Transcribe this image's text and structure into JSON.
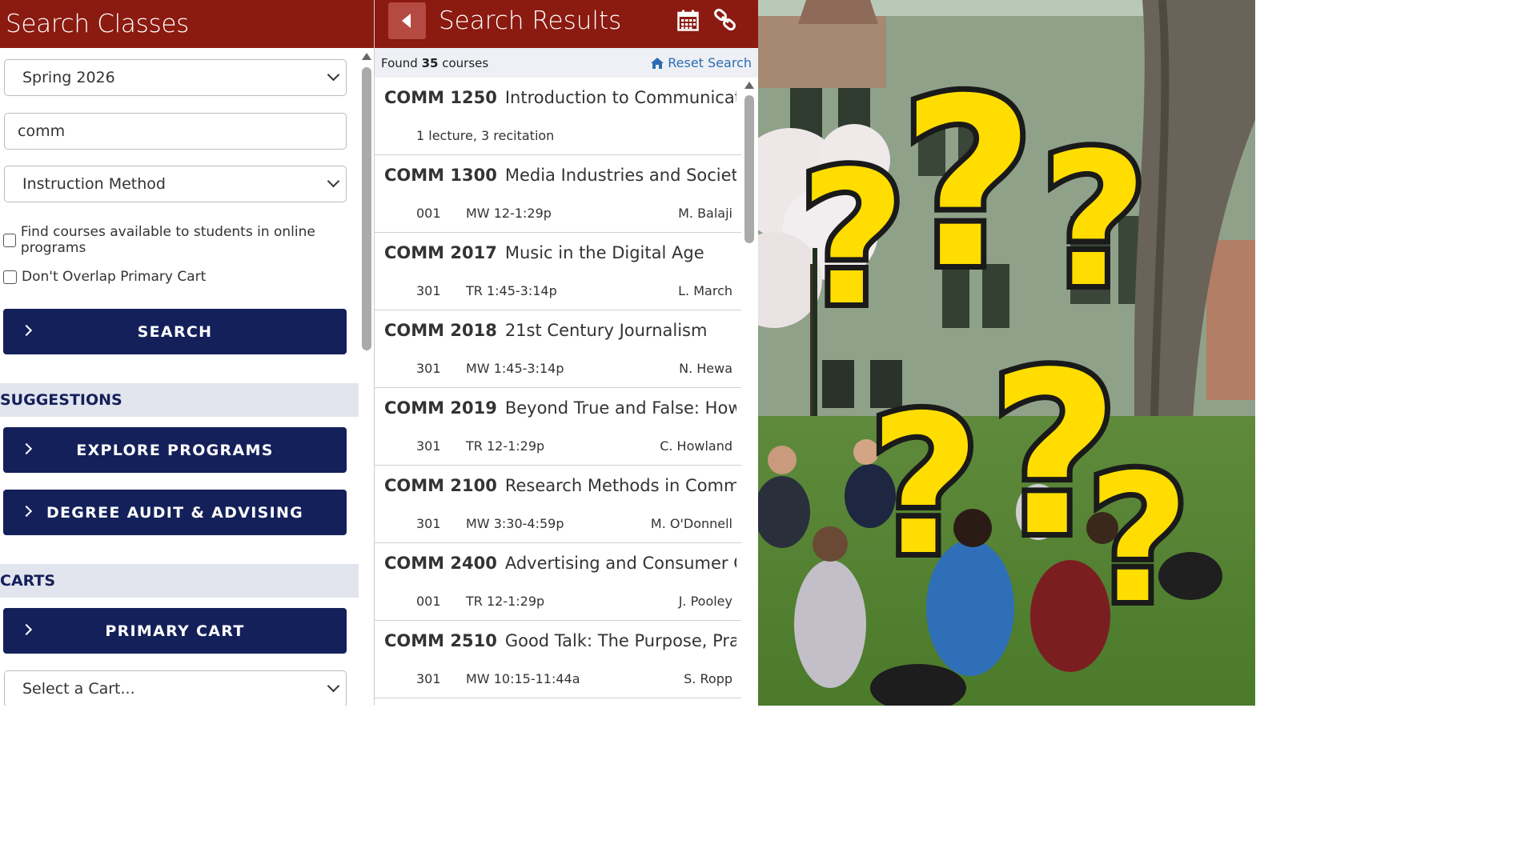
{
  "left": {
    "title": "Search Classes",
    "term_select": "Spring 2026",
    "keyword_value": "comm",
    "instruction_select": "Instruction Method",
    "online_checkbox_label": "Find courses available to students in online programs",
    "overlap_checkbox_label": "Don't Overlap Primary Cart",
    "search_button": "SEARCH",
    "suggestions_heading": "SUGGESTIONS",
    "explore_button": "EXPLORE PROGRAMS",
    "degree_button": "DEGREE AUDIT & ADVISING",
    "carts_heading": "CARTS",
    "primary_cart_button": "PRIMARY CART",
    "cart_select": "Select a Cart..."
  },
  "middle": {
    "title": "Search Results",
    "found_prefix": "Found",
    "found_count": "35",
    "found_suffix": "courses",
    "reset_label": "Reset Search",
    "results": [
      {
        "code": "COMM 1250",
        "title": "Introduction to Communicati...",
        "summary": "1 lecture, 3 recitation"
      },
      {
        "code": "COMM 1300",
        "title": "Media Industries and Society",
        "section": "001",
        "time": "MW 12-1:29p",
        "instructor": "M. Balaji"
      },
      {
        "code": "COMM 2017",
        "title": "Music in the Digital Age",
        "section": "301",
        "time": "TR 1:45-3:14p",
        "instructor": "L. March"
      },
      {
        "code": "COMM 2018",
        "title": "21st Century Journalism",
        "section": "301",
        "time": "MW 1:45-3:14p",
        "instructor": "N. Hewa"
      },
      {
        "code": "COMM 2019",
        "title": "Beyond True and False: How ...",
        "section": "301",
        "time": "TR 12-1:29p",
        "instructor": "C. Howland"
      },
      {
        "code": "COMM 2100",
        "title": "Research Methods in Comm...",
        "section": "301",
        "time": "MW 3:30-4:59p",
        "instructor": "M. O'Donnell"
      },
      {
        "code": "COMM 2400",
        "title": "Advertising and Consumer C...",
        "section": "001",
        "time": "TR 12-1:29p",
        "instructor": "J. Pooley"
      },
      {
        "code": "COMM 2510",
        "title": "Good Talk: The Purpose, Prac...",
        "section": "301",
        "time": "MW 10:15-11:44a",
        "instructor": "S. Ropp"
      }
    ]
  },
  "colors": {
    "header_red": "#8b1a10",
    "navy": "#14205a",
    "link_blue": "#2a6db0",
    "question_yellow": "#ffdd00"
  },
  "icons": [
    "chevron-down-icon",
    "chevron-right-icon",
    "back-arrow-icon",
    "calendar-icon",
    "link-icon",
    "home-icon"
  ]
}
